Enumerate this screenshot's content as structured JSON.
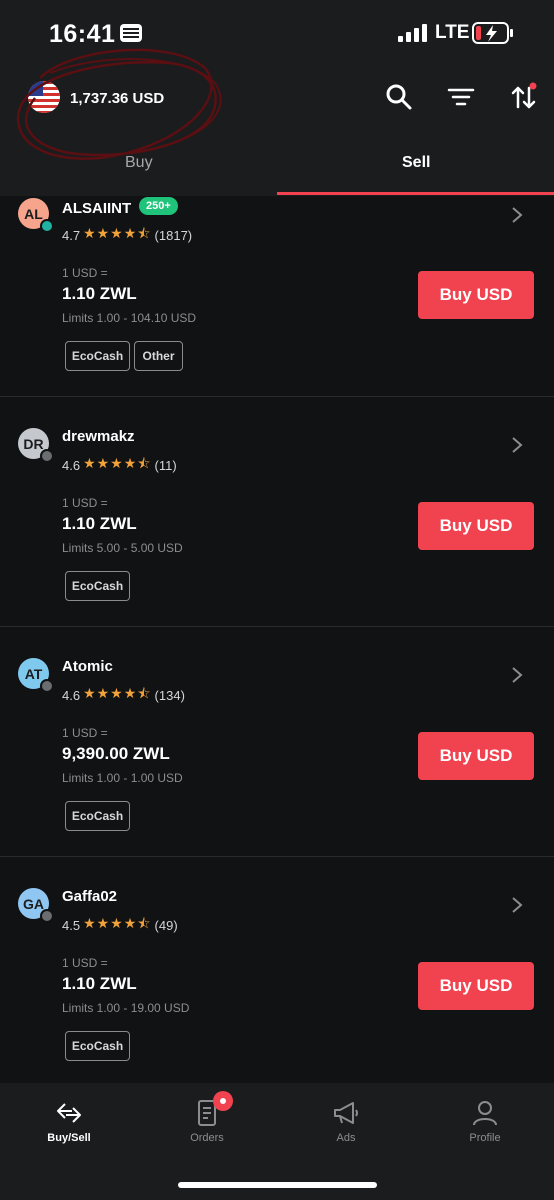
{
  "status_bar": {
    "time": "16:41",
    "network": "LTE"
  },
  "header": {
    "balance": "1,737.36 USD",
    "icons": [
      "flag-us-icon",
      "search-icon",
      "filter-icon",
      "sort-icon"
    ],
    "tabs": [
      {
        "label": "Buy",
        "active": false
      },
      {
        "label": "Sell",
        "active": true
      }
    ]
  },
  "offers": [
    {
      "initials": "AL",
      "avatar_color": "#f6a48c",
      "online": true,
      "name": "ALSAIINT",
      "badge": "250+",
      "rating": "4.7",
      "stars": "★★★★⯪",
      "reviews": "(1817)",
      "rate_label": "1 USD =",
      "price": "1.10 ZWL",
      "limits": "Limits 1.00 - 104.10 USD",
      "methods": [
        "EcoCash",
        "Other"
      ],
      "button": "Buy USD"
    },
    {
      "initials": "DR",
      "avatar_color": "#c5c9ce",
      "online": false,
      "name": "drewmakz",
      "badge": "",
      "rating": "4.6",
      "stars": "★★★★⯪",
      "reviews": "(11)",
      "rate_label": "1 USD =",
      "price": "1.10 ZWL",
      "limits": "Limits 5.00 - 5.00 USD",
      "methods": [
        "EcoCash"
      ],
      "button": "Buy USD"
    },
    {
      "initials": "AT",
      "avatar_color": "#7fc9ef",
      "online": false,
      "name": "Atomic",
      "badge": "",
      "rating": "4.6",
      "stars": "★★★★⯪",
      "reviews": "(134)",
      "rate_label": "1 USD =",
      "price": "9,390.00 ZWL",
      "limits": "Limits 1.00 - 1.00 USD",
      "methods": [
        "EcoCash"
      ],
      "button": "Buy USD"
    },
    {
      "initials": "GA",
      "avatar_color": "#8fc6f2",
      "online": false,
      "name": "Gaffa02",
      "badge": "",
      "rating": "4.5",
      "stars": "★★★★⯪",
      "reviews": "(49)",
      "rate_label": "1 USD =",
      "price": "1.10 ZWL",
      "limits": "Limits 1.00 - 19.00 USD",
      "methods": [
        "EcoCash"
      ],
      "button": "Buy USD"
    }
  ],
  "bottom_nav": [
    {
      "label": "Buy/Sell",
      "icon": "swap-arrows-icon",
      "active": true
    },
    {
      "label": "Orders",
      "icon": "orders-icon",
      "active": false,
      "notification": true
    },
    {
      "label": "Ads",
      "icon": "megaphone-icon",
      "active": false
    },
    {
      "label": "Profile",
      "icon": "profile-icon",
      "active": false
    }
  ],
  "colors": {
    "accent": "#f0424f",
    "background": "#111214",
    "surface": "#1b1c1e",
    "star": "#f2a23a",
    "badge": "#20c37a"
  }
}
